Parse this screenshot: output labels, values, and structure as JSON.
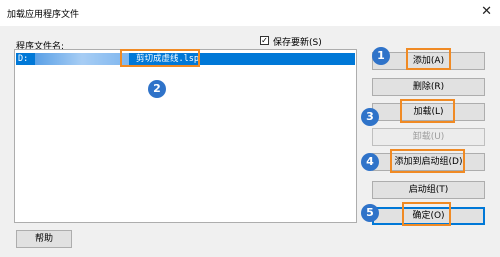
{
  "window": {
    "title": "加载应用程序文件",
    "close_glyph": "✕"
  },
  "list": {
    "label": "程序文件名:",
    "selected_drive": "D:",
    "selected_file": "剪切成虚线.lsp"
  },
  "save_list": {
    "label": "保存要新(S)",
    "checked": true,
    "check_glyph": "✓"
  },
  "buttons": {
    "add": "添加(A)",
    "remove": "删除(R)",
    "load": "加载(L)",
    "unload": "卸载(U)",
    "add_startup": "添加到启动组(D)",
    "startup": "启动组(T)",
    "ok": "确定(O)",
    "help": "帮助"
  },
  "callouts": [
    "1",
    "2",
    "3",
    "4",
    "5"
  ],
  "colors": {
    "highlight": "#f08a24",
    "badge": "#2f73c9",
    "selection": "#0078d7"
  }
}
